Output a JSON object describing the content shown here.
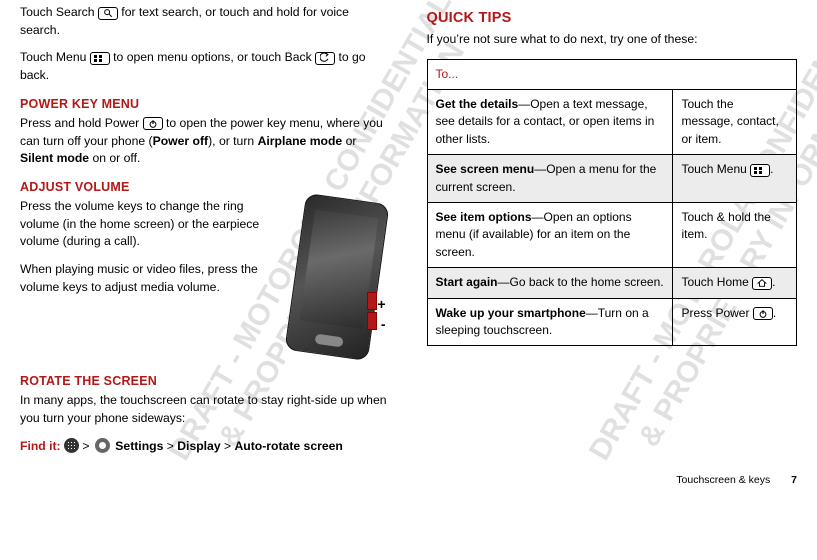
{
  "left": {
    "p1_a": "Touch Search ",
    "p1_b": " for text search, or touch and hold for voice search.",
    "p2_a": "Touch Menu ",
    "p2_b": " to open menu options, or touch Back ",
    "p2_c": " to go back.",
    "h_power": "Power key menu",
    "p3_a": "Press and hold Power ",
    "p3_b": " to open the power key menu, where you can turn off your phone (",
    "p3_bold1": "Power off",
    "p3_c": "), or turn ",
    "p3_bold2": "Airplane mode",
    "p3_d": " or ",
    "p3_bold3": "Silent mode",
    "p3_e": " on or off.",
    "h_vol": "Adjust volume",
    "p4": "Press the volume keys to change the ring volume (in the home screen) or the earpiece volume (during a call).",
    "p5": "When playing music or video files, press the volume keys to adjust media volume.",
    "h_rotate": "Rotate the screen",
    "p6": "In many apps, the touchscreen can rotate to stay right-side up when you turn your phone sideways:",
    "findit": "Find it:",
    "path_settings": "Settings",
    "path_display": "Display",
    "path_auto": "Auto-rotate screen"
  },
  "right": {
    "h_tips": "Quick tips",
    "intro": "If you’re not sure what to do next, try one of these:",
    "th": "To...",
    "rows": [
      {
        "l_bold": "Get the details",
        "l_rest": "—Open a text message, see details for a contact, or open items in other lists.",
        "r": "Touch the message, contact, or item."
      },
      {
        "l_bold": "See screen menu",
        "l_rest": "—Open a menu for the current screen.",
        "r_a": "Touch Menu ",
        "r_b": ".",
        "menu_icon": true
      },
      {
        "l_bold": "See item options",
        "l_rest": "—Open an options menu (if available) for an item on the screen.",
        "r": "Touch & hold the item."
      },
      {
        "l_bold": "Start again",
        "l_rest": "—Go back to the home screen.",
        "r_a": "Touch Home ",
        "r_b": ".",
        "home_icon": true
      },
      {
        "l_bold": "Wake up your smartphone",
        "l_rest": "—Turn on a sleeping touchscreen.",
        "r_a": "Press Power ",
        "r_b": ".",
        "power_icon": true
      }
    ]
  },
  "footer": {
    "section": "Touchscreen & keys",
    "page": "7"
  },
  "watermark": "DRAFT - MOTOROLA CONFIDENTIAL\n& PROPRIETARY INFORMATION"
}
